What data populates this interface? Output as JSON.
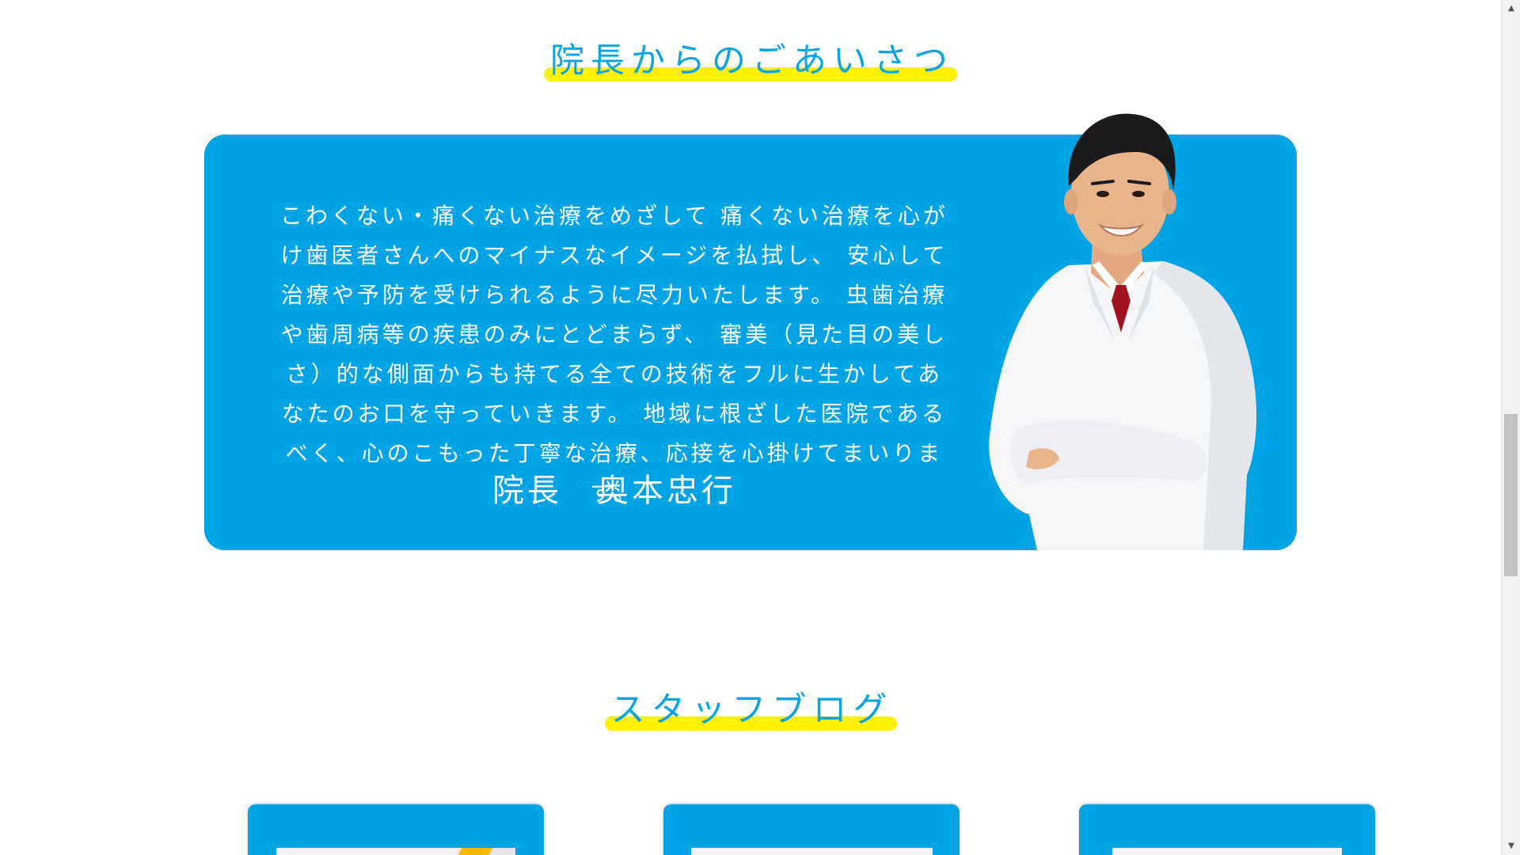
{
  "greeting": {
    "title": "院長からのごあいさつ",
    "message": "こわくない・痛くない治療をめざして 痛くない治療を心がけ歯医者さんへのマイナスなイメージを払拭し、 安心して治療や予防を受けられるように尽力いたします。 虫歯治療や歯周病等の疾患のみにとどまらず、 審美（見た目の美しさ）的な側面からも持てる全ての技術をフルに生かしてあなたのお口を守っていきます。 地域に根ざした医院であるべく、心のこもった丁寧な治療、応接を心掛けてまいります。",
    "signature": "院長　奥本忠行"
  },
  "blog": {
    "title": "スタッフブログ"
  },
  "colors": {
    "accent_blue": "#00a3e4",
    "title_blue": "#0aa4e2",
    "marker_yellow": "#fff200"
  },
  "scrollbar": {
    "up_icon": "arrow-up-icon",
    "down_icon": "arrow-down-icon"
  }
}
